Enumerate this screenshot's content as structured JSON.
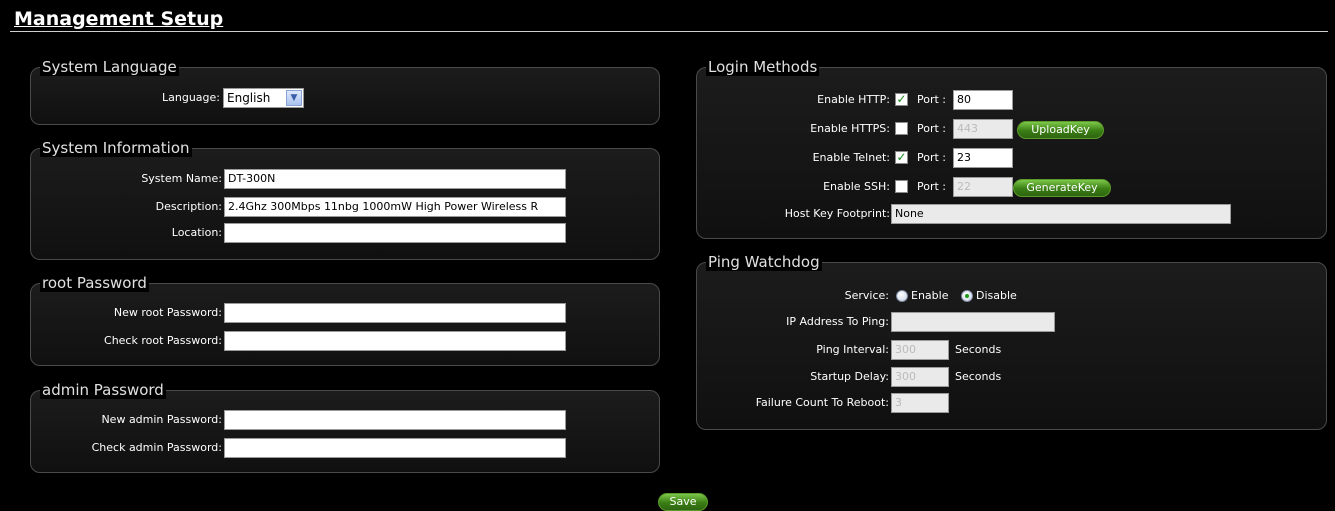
{
  "page": {
    "title": "Management Setup"
  },
  "system_language": {
    "legend": "System Language",
    "language_label": "Language:",
    "language_value": "English"
  },
  "system_information": {
    "legend": "System Information",
    "name_label": "System Name:",
    "name_value": "DT-300N",
    "description_label": "Description:",
    "description_value": "2.4Ghz 300Mbps 11nbg 1000mW High Power Wireless R",
    "location_label": "Location:",
    "location_value": ""
  },
  "root_password": {
    "legend": "root Password",
    "new_label": "New root Password:",
    "check_label": "Check root Password:"
  },
  "admin_password": {
    "legend": "admin Password",
    "new_label": "New admin Password:",
    "check_label": "Check admin Password:"
  },
  "login_methods": {
    "legend": "Login Methods",
    "port_label": "Port :",
    "http": {
      "label": "Enable HTTP:",
      "checked": true,
      "port": "80"
    },
    "https": {
      "label": "Enable HTTPS:",
      "checked": false,
      "port": "443",
      "button": "UploadKey"
    },
    "telnet": {
      "label": "Enable Telnet:",
      "checked": true,
      "port": "23"
    },
    "ssh": {
      "label": "Enable SSH:",
      "checked": false,
      "port": "22",
      "button": "GenerateKey"
    },
    "host_key_label": "Host Key Footprint:",
    "host_key_value": "None"
  },
  "ping_watchdog": {
    "legend": "Ping Watchdog",
    "service_label": "Service:",
    "enable_label": "Enable",
    "disable_label": "Disable",
    "ip_label": "IP Address To Ping:",
    "ip_value": "",
    "interval_label": "Ping Interval:",
    "interval_value": "300",
    "startup_label": "Startup Delay:",
    "startup_value": "300",
    "seconds_label": "Seconds",
    "failure_label": "Failure Count To Reboot:",
    "failure_value": "3"
  },
  "save_label": "Save",
  "colors": {
    "button_green": "#3a7d14",
    "background": "#000000"
  }
}
